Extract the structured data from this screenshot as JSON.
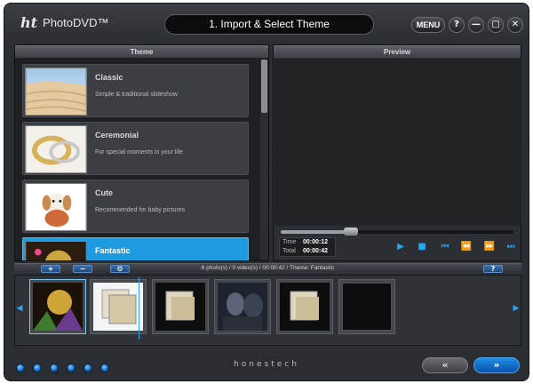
{
  "titlebar": {
    "logo_mark": "ht",
    "app_name": "PhotoDVD™",
    "step_title": "1. Import & Select Theme",
    "menu_label": "MENU",
    "help_label": "?",
    "minimize_label": "—",
    "maximize_label": "□",
    "close_label": "✕"
  },
  "theme_panel": {
    "header": "Theme",
    "items": [
      {
        "name": "Classic",
        "description": "Simple & traditional slideshow",
        "icon": "sand-dunes-thumbnail"
      },
      {
        "name": "Ceremonial",
        "description": "For special moments in your life",
        "icon": "wedding-rings-thumbnail"
      },
      {
        "name": "Cute",
        "description": "Recommended for baby pictures",
        "icon": "puppy-thumbnail"
      },
      {
        "name": "Fantastic",
        "description": "",
        "icon": "fantasy-scene-thumbnail",
        "selected": true
      }
    ]
  },
  "preview_panel": {
    "header": "Preview",
    "time_label": "Time",
    "time_value": "00:00:12",
    "total_label": "Total",
    "total_value": "00:00:42",
    "seek_progress": 0.3,
    "controls": {
      "play": "▶",
      "stop": "■",
      "first": "⏮",
      "rewind": "⏪",
      "forward": "⏩",
      "last": "⏭"
    }
  },
  "storyboard": {
    "add_label": "+",
    "remove_label": "−",
    "settings_label": "⚙",
    "info": "6 photo(s) / 0 video(s) / 00:00:42 / Theme: Fantastic",
    "help_label": "?",
    "left_arrow": "◀",
    "right_arrow": "▶",
    "slots": [
      {
        "kind": "fantasy-photo"
      },
      {
        "kind": "collage-photo"
      },
      {
        "kind": "collage-photo"
      },
      {
        "kind": "people-photo"
      },
      {
        "kind": "collage-photo"
      },
      {
        "kind": "empty"
      }
    ]
  },
  "footer": {
    "brand": "honestech",
    "back_label": "«",
    "next_label": "»",
    "dot_count": 6
  },
  "colors": {
    "accent": "#1e9be0",
    "window_bg": "#2b2e32",
    "panel_bg": "#1e2023"
  }
}
